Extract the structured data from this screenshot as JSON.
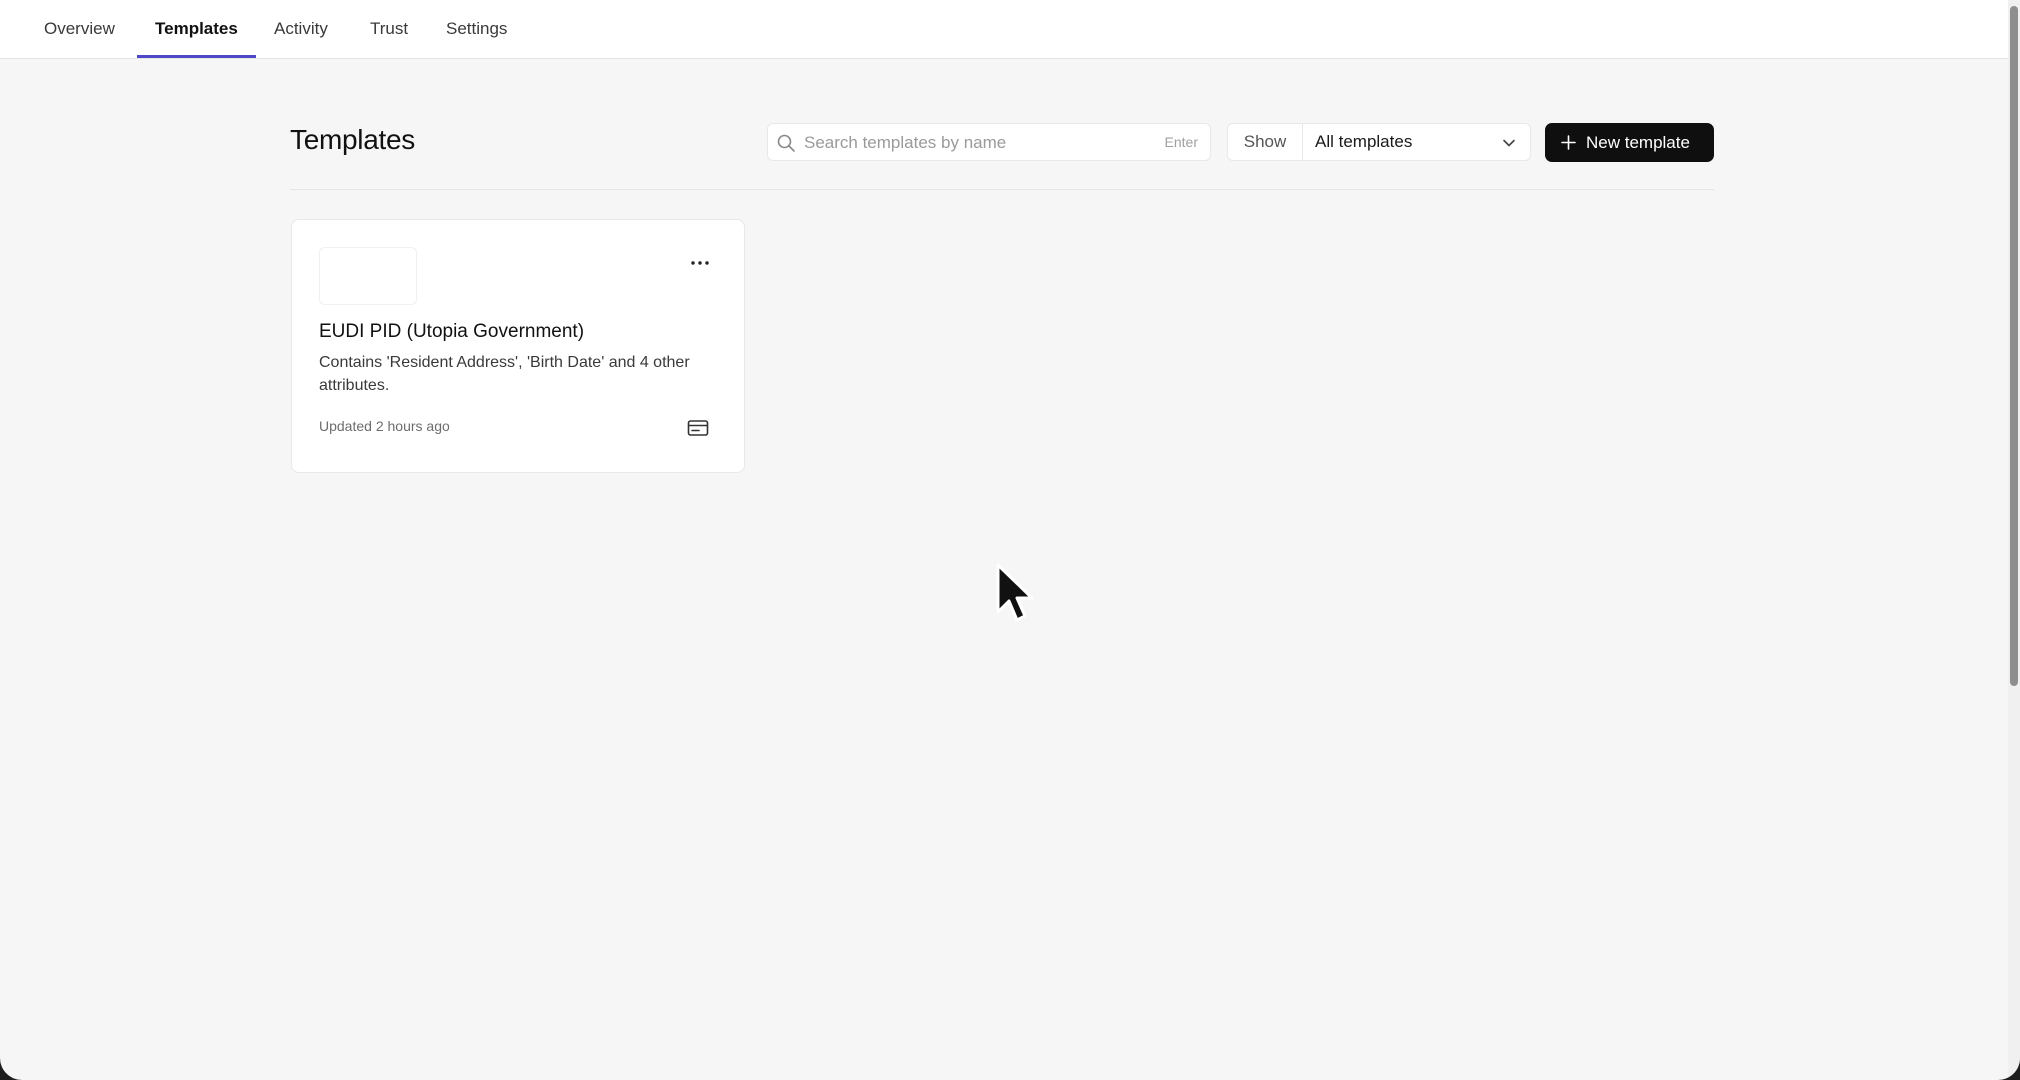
{
  "nav": {
    "tabs": [
      {
        "label": "Overview"
      },
      {
        "label": "Templates"
      },
      {
        "label": "Activity"
      },
      {
        "label": "Trust"
      },
      {
        "label": "Settings"
      }
    ],
    "active_tab": "Templates"
  },
  "page": {
    "title": "Templates"
  },
  "search": {
    "placeholder": "Search templates by name",
    "value": "",
    "hint": "Enter"
  },
  "filter": {
    "label": "Show",
    "selected": "All templates"
  },
  "new_button": {
    "label": "New template"
  },
  "templates": [
    {
      "title": "EUDI PID (Utopia Government)",
      "description": "Contains 'Resident Address', 'Birth Date' and 4 other attributes.",
      "updated": "Updated 2 hours ago",
      "type_icon": "credit-card-icon"
    }
  ],
  "colors": {
    "accent": "#4f46c8",
    "primary_button": "#0f0f0f",
    "background": "#f6f6f6"
  },
  "icons": {
    "search": "search-icon",
    "dropdown": "chevron-down-icon",
    "add": "plus-icon",
    "more": "more-horizontal-icon",
    "card_type": "credit-card-icon",
    "cursor": "mouse-pointer-icon"
  }
}
